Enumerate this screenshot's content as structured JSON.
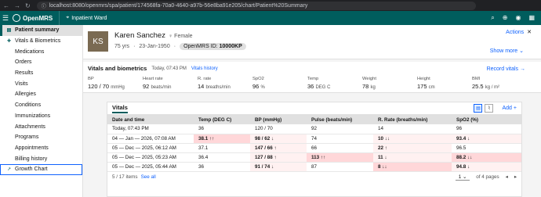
{
  "browser": {
    "url": "localhost:8080/openmrs/spa/patient/174568fa-70a0-4640-a97b-56e8ba91e205/chart/Patient%20Summary"
  },
  "header": {
    "app_name": "OpenMRS",
    "location": "Inpatient Ward"
  },
  "sidebar": {
    "items": [
      {
        "label": "Patient summary"
      },
      {
        "label": "Vitals & Biometrics"
      },
      {
        "label": "Medications"
      },
      {
        "label": "Orders"
      },
      {
        "label": "Results"
      },
      {
        "label": "Visits"
      },
      {
        "label": "Allergies"
      },
      {
        "label": "Conditions"
      },
      {
        "label": "Immunizations"
      },
      {
        "label": "Attachments"
      },
      {
        "label": "Programs"
      },
      {
        "label": "Appointments"
      },
      {
        "label": "Billing history"
      },
      {
        "label": "Growth Chart"
      }
    ]
  },
  "patient": {
    "initials": "KS",
    "name": "Karen Sanchez",
    "gender": "Female",
    "age": "75 yrs",
    "dob": "23-Jan-1950",
    "id_label": "OpenMRS ID:",
    "id_value": "10000KP",
    "actions_label": "Actions",
    "show_more": "Show more"
  },
  "biometrics": {
    "title": "Vitals and biometrics",
    "date": "Today, 07:43 PM",
    "history_link": "Vitals history",
    "record_link": "Record vitals",
    "cells": [
      {
        "label": "BP",
        "value": "120 / 70",
        "unit": "mmHg"
      },
      {
        "label": "Heart rate",
        "value": "92",
        "unit": "beats/min"
      },
      {
        "label": "R. rate",
        "value": "14",
        "unit": "breaths/min"
      },
      {
        "label": "SpO2",
        "value": "96",
        "unit": "%"
      },
      {
        "label": "Temp",
        "value": "36",
        "unit": "DEG C"
      },
      {
        "label": "Weight",
        "value": "78",
        "unit": "kg"
      },
      {
        "label": "Height",
        "value": "175",
        "unit": "cm"
      },
      {
        "label": "BMI",
        "value": "25.5",
        "unit": "kg / m²"
      }
    ]
  },
  "vitals_table": {
    "title": "Vitals",
    "add_label": "Add",
    "columns": [
      "Date and time",
      "Temp (DEG C)",
      "BP (mmHg)",
      "Pulse (beats/min)",
      "R. Rate (breaths/min)",
      "SpO2 (%)"
    ],
    "rows": [
      [
        "Today, 07:43 PM",
        "36",
        "120 / 70",
        "92",
        "14",
        "96"
      ],
      [
        "04 — Jan — 2026, 07:08 AM",
        "38.1 ↑↑",
        "98 / 62 ↓",
        "74",
        "10 ↓↓",
        "93.4 ↓"
      ],
      [
        "05 — Dec — 2025, 06:12 AM",
        "37.1",
        "147 / 66 ↑",
        "66",
        "22 ↑",
        "96.5"
      ],
      [
        "05 — Dec — 2025, 05:23 AM",
        "36.4",
        "127 / 88 ↑",
        "113 ↑↑",
        "11 ↓",
        "88.2 ↓↓"
      ],
      [
        "05 — Dec — 2025, 05:44 AM",
        "36",
        "91 / 74 ↓",
        "87",
        "8 ↓↓",
        "94.8 ↓"
      ]
    ],
    "footer_count": "5 / 17 items",
    "see_all": "See all",
    "page_select": "1",
    "page_of": "of 4 pages"
  }
}
